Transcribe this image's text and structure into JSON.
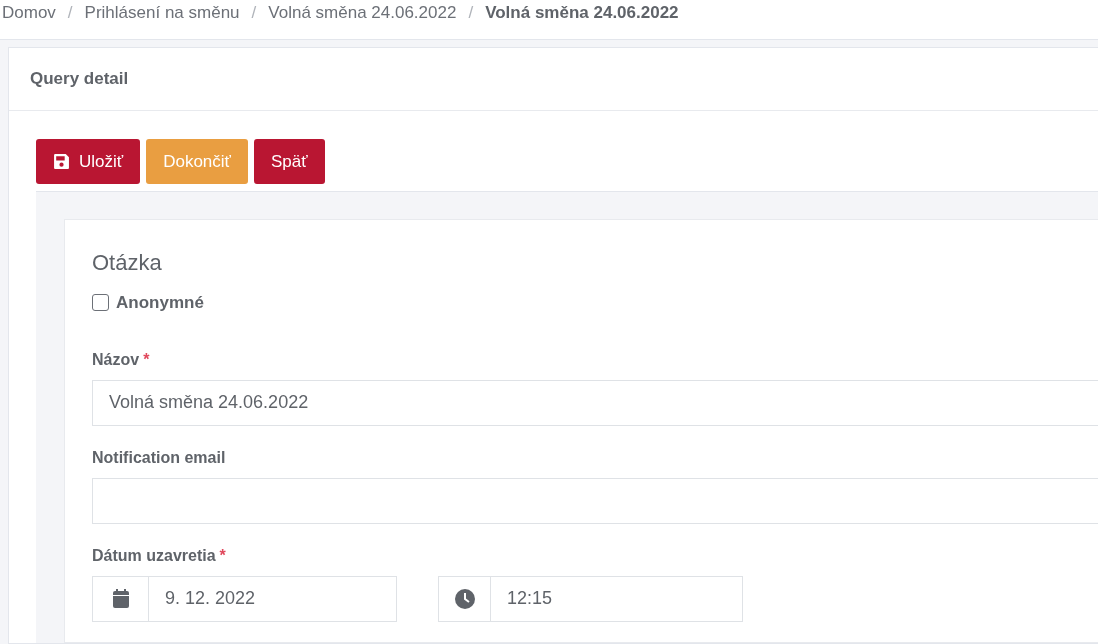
{
  "breadcrumb": [
    {
      "label": "Domov",
      "current": false
    },
    {
      "label": "Prihlásení na směnu",
      "current": false
    },
    {
      "label": "Volná směna 24.06.2022",
      "current": false
    },
    {
      "label": "Volná směna 24.06.2022",
      "current": true
    }
  ],
  "breadcrumb_separator": "/",
  "card_title": "Query detail",
  "buttons": [
    {
      "label": "Uložiť",
      "kind": "save"
    },
    {
      "label": "Dokončiť",
      "kind": "finish"
    },
    {
      "label": "Späť",
      "kind": "back"
    }
  ],
  "section_title": "Otázka",
  "anonymous": {
    "label": "Anonymné",
    "checked": false
  },
  "fields": [
    {
      "label": "Názov",
      "required": true,
      "value": "Volná směna 24.06.2022"
    },
    {
      "label": "Notification email",
      "required": false
    }
  ],
  "required_mark": "*",
  "closing_date": {
    "label": "Dátum uzavretia",
    "required": true,
    "date": "9. 12. 2022",
    "time": "12:15"
  }
}
